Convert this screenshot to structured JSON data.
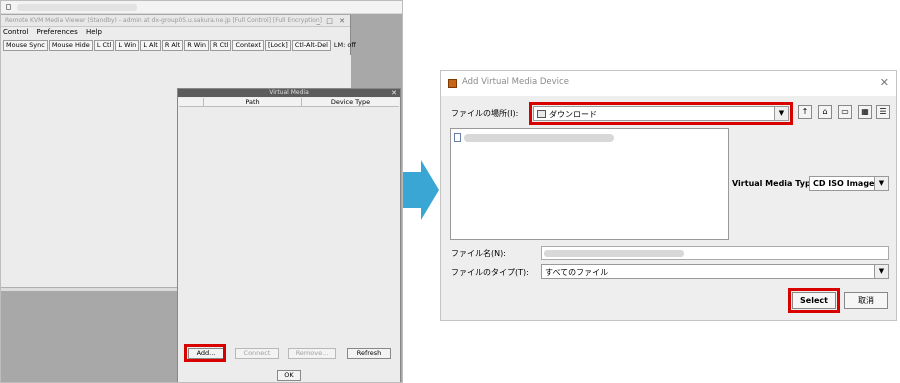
{
  "kvm": {
    "title": "Remote KVM Media Viewer (Standby) - admin at dx-group05.u.sakura.ne.jp [Full Control] [Full Encryption]",
    "window_controls": "_ □ ✕",
    "menu": [
      "Control",
      "Preferences",
      "Help"
    ],
    "toolbar": [
      "Mouse Sync",
      "Mouse Hide",
      "L Ctl",
      "L Win",
      "L Alt",
      "R Alt",
      "R Win",
      "R Ctl",
      "Context",
      "[Lock]",
      "Ctl-Alt-Del"
    ],
    "lm_status": "LM: off"
  },
  "virtual_media": {
    "title": "Virtual Media",
    "close": "✕",
    "columns": [
      "",
      "Path",
      "Device Type"
    ],
    "buttons": {
      "add": "Add...",
      "connect": "Connect",
      "remove": "Remove...",
      "refresh": "Refresh",
      "ok": "OK"
    }
  },
  "avd": {
    "title": "Add Virtual Media Device",
    "close": "✕",
    "look_in_label": "ファイルの場所(I):",
    "look_in_value": "ダウンロード",
    "nav_icons": [
      "up-folder-icon",
      "home-icon",
      "new-folder-icon",
      "list-view-icon",
      "details-view-icon"
    ],
    "vmt_label": "Virtual Media Type:",
    "vmt_value": "CD ISO Image",
    "file_name_label": "ファイル名(N):",
    "file_type_label": "ファイルのタイプ(T):",
    "file_type_value": "すべてのファイル",
    "select": "Select",
    "cancel": "取消"
  },
  "colors": {
    "highlight": "#d90000",
    "arrow": "#3aa6d4"
  }
}
